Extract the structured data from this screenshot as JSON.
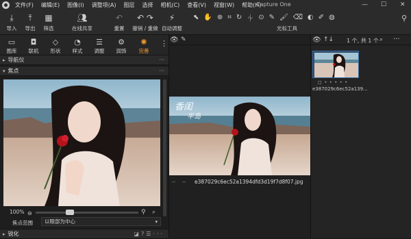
{
  "menubar": {
    "items": [
      "文件(F)",
      "编辑(E)",
      "图像(I)",
      "调整项(A)",
      "图层",
      "选择",
      "相机(C)",
      "查看(V)",
      "视窗(W)",
      "帮助(H)"
    ],
    "app_title": "Capture One",
    "minimize": "—",
    "maximize": "☐",
    "close": "✕"
  },
  "toolbar": {
    "import": "导入",
    "export": "导出",
    "filter": "筛选",
    "share": "在线共享",
    "reset": "重置",
    "undo_redo": "撤销 / 重做",
    "auto_adjust": "自动调整",
    "cursor_tools": "光标工具"
  },
  "tool_tabs": {
    "items": [
      "图库",
      "联机",
      "形状",
      "样式",
      "调整",
      "润饰",
      "完善"
    ],
    "active": "完善",
    "accent_color": "#f29a32"
  },
  "left_panel": {
    "navigator_title": "导航仪",
    "focus_title": "焦点",
    "zoom_value": "100%",
    "focus_range_label": "焦点范围",
    "focus_range_value": "以眼部为中心",
    "sharpen_title": "锐化"
  },
  "viewer": {
    "filename": "e387029c6ec52a1394dfd3d19f7d8f07.jpg",
    "left_caption_1": "--",
    "left_caption_2": "--",
    "watermark_line1": "香闺",
    "watermark_line2": "半岛"
  },
  "browser": {
    "count_text": "1 个, 共 1 个",
    "thumb_caption": "e387029c6ec52a139...",
    "rating_dots": "□ • • • • •",
    "sort_icon": "↑↓"
  }
}
